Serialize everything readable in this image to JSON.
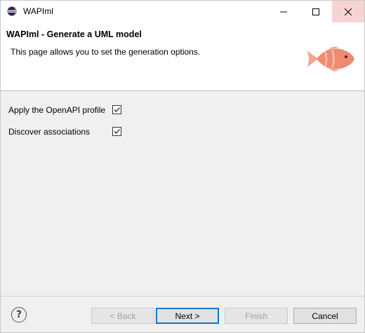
{
  "window": {
    "title": "WAPIml",
    "close_hover_color": "#f7d4d4"
  },
  "header": {
    "title": "WAPIml - Generate a UML model",
    "description": "This page allows you to set the generation options.",
    "banner_icon": "fish-icon",
    "banner_color": "#f08a72"
  },
  "options": [
    {
      "label": "Apply the OpenAPI profile",
      "checked": true
    },
    {
      "label": "Discover associations",
      "checked": true
    }
  ],
  "footer": {
    "help_icon": "?",
    "back_label": "< Back",
    "next_label": "Next >",
    "finish_label": "Finish",
    "cancel_label": "Cancel",
    "back_enabled": false,
    "finish_enabled": false,
    "accent_color": "#0078d7"
  }
}
